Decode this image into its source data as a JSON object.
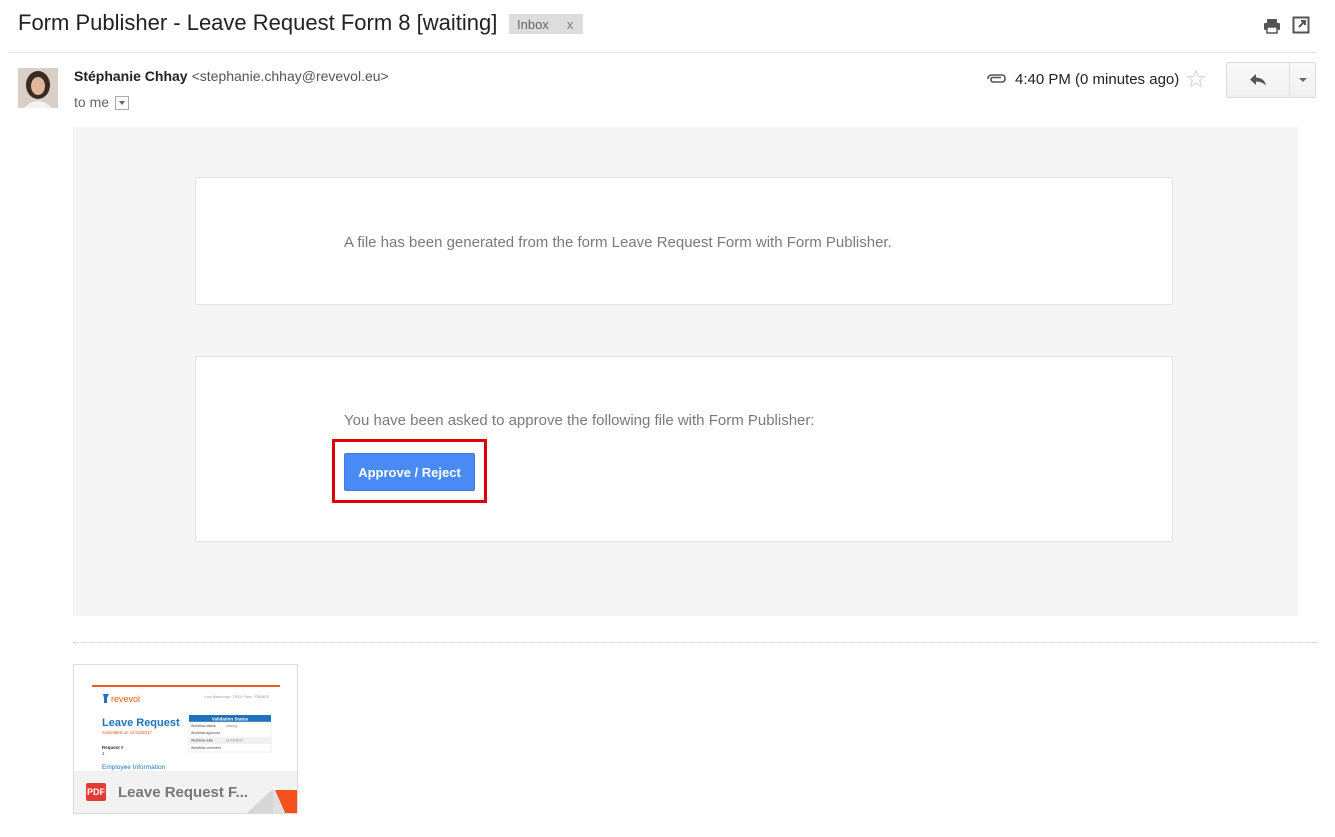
{
  "email": {
    "subject": "Form Publisher - Leave Request Form 8 [waiting]",
    "label": "Inbox",
    "label_remove": "x",
    "sender_name": "Stéphanie Chhay",
    "sender_email": "<stephanie.chhay@revevol.eu>",
    "to": "to me",
    "time": "4:40 PM (0 minutes ago)"
  },
  "toolbar": {
    "print_icon": "print-icon",
    "new_window_icon": "open-in-new-window-icon",
    "attachment_icon": "paperclip-icon",
    "star_icon": "star-icon",
    "reply_icon": "reply-icon",
    "more_icon": "dropdown-arrow-icon"
  },
  "body": {
    "message1": "A file has been generated from the form Leave Request Form with Form Publisher.",
    "message2": "You have been asked to approve the following file with Form Publisher:",
    "button_label": "Approve / Reject"
  },
  "attachment": {
    "badge": "PDF",
    "filename": "Leave Request F...",
    "preview": {
      "logo": "revevol",
      "address": "4 rue Bobeuvray · 75001 Paris · FRANCE",
      "title": "Leave Request",
      "submitted": "Submitted on 11/15/2017",
      "request_label": "Request #",
      "request_value": "1",
      "section": "Employee Information",
      "table_title": "Validation Status",
      "rows": [
        {
          "k": "Workflow status",
          "v": "waiting"
        },
        {
          "k": "Workflow approver",
          "v": ""
        },
        {
          "k": "Workflow date",
          "v": "11/15/2017"
        },
        {
          "k": "Workflow comment",
          "v": ""
        }
      ]
    }
  },
  "colors": {
    "button": "#4a8af4",
    "highlight": "#e00000",
    "pdf": "#e53935",
    "revevol_orange": "#f05a22",
    "revevol_blue": "#1e73be"
  }
}
